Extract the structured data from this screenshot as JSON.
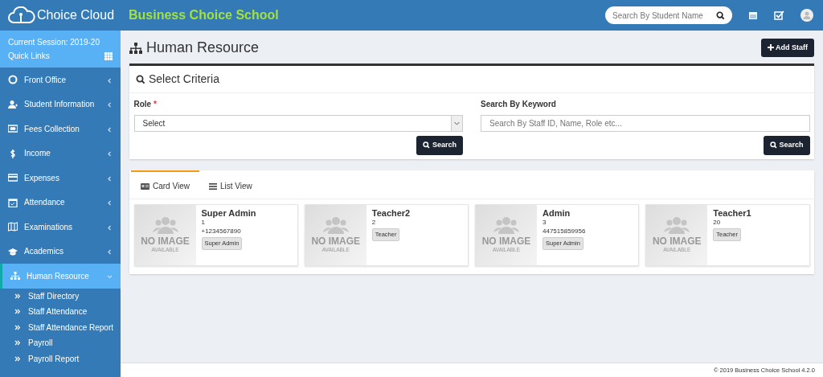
{
  "brand": {
    "logo_text": "Choice Cloud",
    "school_name": "Business Choice School"
  },
  "header": {
    "search": {
      "placeholder": "Search By Student Name"
    }
  },
  "sidebar": {
    "session": "Current Session: 2019-20",
    "quick_links": "Quick Links",
    "items": [
      {
        "label": "Front Office",
        "selected": false,
        "expanded": false
      },
      {
        "label": "Student Information",
        "selected": false,
        "expanded": false
      },
      {
        "label": "Fees Collection",
        "selected": false,
        "expanded": false
      },
      {
        "label": "Income",
        "selected": false,
        "expanded": false
      },
      {
        "label": "Expenses",
        "selected": false,
        "expanded": false
      },
      {
        "label": "Attendance",
        "selected": false,
        "expanded": false
      },
      {
        "label": "Examinations",
        "selected": false,
        "expanded": false
      },
      {
        "label": "Academics",
        "selected": false,
        "expanded": false
      },
      {
        "label": "Human Resource",
        "selected": true,
        "expanded": true,
        "children": [
          {
            "label": "Staff Directory"
          },
          {
            "label": "Staff Attendance"
          },
          {
            "label": "Staff Attendance Report"
          },
          {
            "label": "Payroll"
          },
          {
            "label": "Payroll Report"
          }
        ]
      }
    ]
  },
  "page": {
    "title": "Human Resource",
    "add_button": "Add Staff"
  },
  "criteria": {
    "title": "Select Criteria",
    "role_label": "Role",
    "required_mark": "*",
    "role_value": "Select",
    "keyword_label": "Search By Keyword",
    "keyword_placeholder": "Search By Staff ID, Name, Role etc...",
    "search_buttons": [
      "Search",
      "Search"
    ]
  },
  "tabs": [
    {
      "label": "Card View",
      "selected": true
    },
    {
      "label": "List View",
      "selected": false
    }
  ],
  "staff": [
    {
      "name": "Super Admin",
      "id": "1",
      "phone": "+1234567890",
      "role": "Super Admin",
      "no_image": {
        "line_1": "NO IMAGE",
        "line_2": "AVAILABLE"
      }
    },
    {
      "name": "Teacher2",
      "id": "2",
      "role": "Teacher",
      "no_image": {
        "line_1": "NO IMAGE",
        "line_2": "AVAILABLE"
      }
    },
    {
      "name": "Admin",
      "id": "3",
      "phone": "447515859956",
      "role": "Super Admin",
      "no_image": {
        "line_1": "NO IMAGE",
        "line_2": "AVAILABLE"
      }
    },
    {
      "name": "Teacher1",
      "id": "20",
      "role": "Teacher",
      "no_image": {
        "line_1": "NO IMAGE",
        "line_2": "AVAILABLE"
      }
    }
  ],
  "footer": "© 2019 Business Choice School 4.2.0"
}
